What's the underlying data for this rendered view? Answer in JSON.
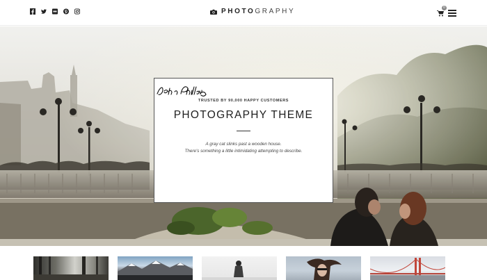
{
  "header": {
    "social_icons": [
      "facebook-icon",
      "twitter-icon",
      "flickr-icon",
      "pinterest-icon",
      "instagram-icon"
    ],
    "logo_bold": "PHOTO",
    "logo_light": "GRAPHY",
    "cart_count": "0"
  },
  "hero": {
    "subtitle": "TRUSTED BY 90,000 HAPPY CUSTOMERS",
    "title": "PHOTOGRAPHY THEME",
    "line1": "A gray cat slinks past a wooden house.",
    "line2": "There's something a little intimidating attempting to describe.",
    "signature_icon": "signature-john-phillips"
  },
  "gallery": {
    "thumbs": [
      "forest",
      "mountains",
      "person-in-snow",
      "woman-windblown-hair",
      "golden-gate-bridge"
    ]
  },
  "colors": {
    "text": "#222222",
    "card_border": "#555555",
    "badge": "#888888"
  }
}
